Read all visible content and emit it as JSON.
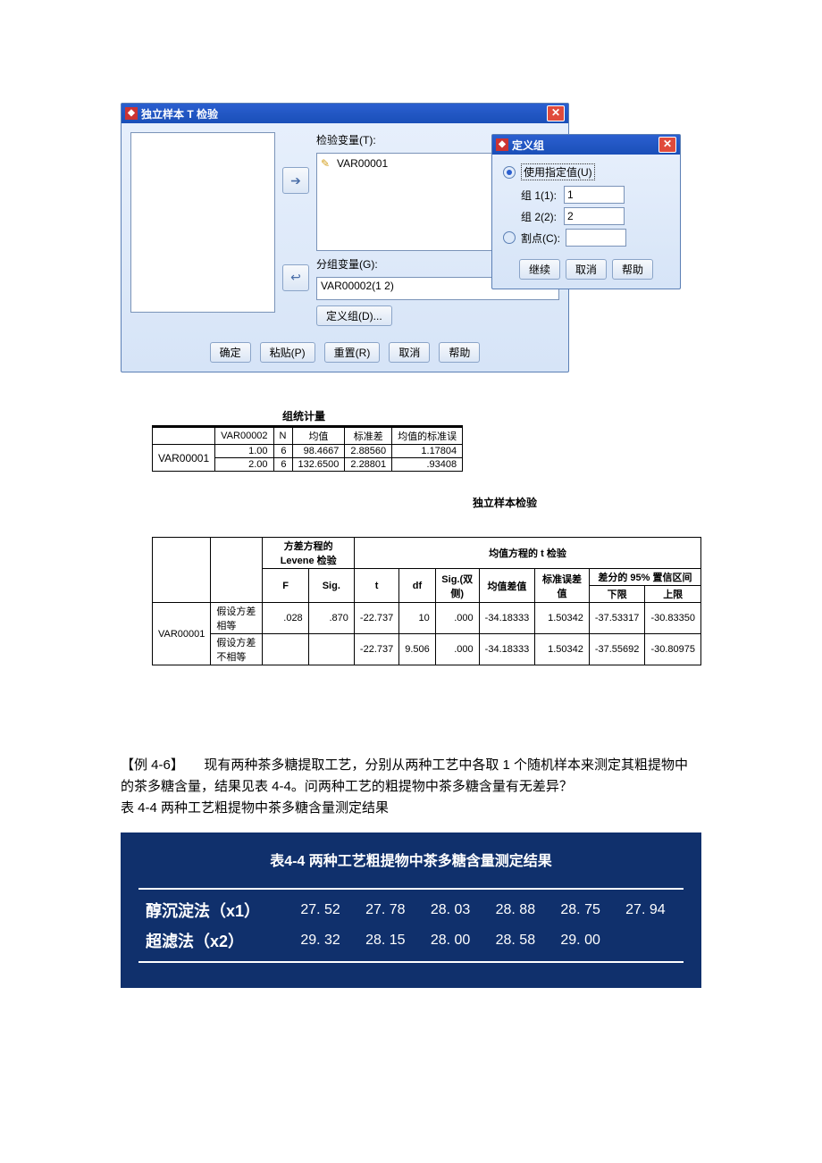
{
  "dlg1": {
    "title": "独立样本 T 检验",
    "test_var_label": "检验变量(T):",
    "test_var_item": "VAR00001",
    "group_var_label": "分组变量(G):",
    "group_var_value": "VAR00002(1 2)",
    "define_group_btn": "定义组(D)...",
    "buttons": {
      "ok": "确定",
      "paste": "粘贴(P)",
      "reset": "重置(R)",
      "cancel": "取消",
      "help": "帮助"
    }
  },
  "dlg2": {
    "title": "定义组",
    "use_specified_label": "使用指定值(U)",
    "group1_label": "组 1(1):",
    "group1_value": "1",
    "group2_label": "组 2(2):",
    "group2_value": "2",
    "cutpoint_label": "割点(C):",
    "buttons": {
      "continue": "继续",
      "cancel": "取消",
      "help": "帮助"
    }
  },
  "group_stats": {
    "title": "组统计量",
    "headers": {
      "grp": "VAR00002",
      "n": "N",
      "mean": "均值",
      "sd": "标准差",
      "se": "均值的标准误"
    },
    "rowvar": "VAR00001",
    "rows": [
      {
        "grp": "1.00",
        "n": "6",
        "mean": "98.4667",
        "sd": "2.88560",
        "se": "1.17804"
      },
      {
        "grp": "2.00",
        "n": "6",
        "mean": "132.6500",
        "sd": "2.28801",
        "se": ".93408"
      }
    ]
  },
  "ind_test": {
    "title": "独立样本检验",
    "levene_header": "方差方程的 Levene 检验",
    "t_header": "均值方程的 t 检验",
    "ci_header": "差分的 95% 置信区间",
    "cols": {
      "F": "F",
      "Sig": "Sig.",
      "t": "t",
      "df": "df",
      "sig2": "Sig.(双侧)",
      "meandiff": "均值差值",
      "sediff": "标准误差值",
      "lower": "下限",
      "upper": "上限"
    },
    "rowvar": "VAR00001",
    "row1_label": "假设方差相等",
    "row2_label": "假设方差不相等",
    "rows": [
      {
        "F": ".028",
        "Sig": ".870",
        "t": "-22.737",
        "df": "10",
        "sig2": ".000",
        "meandiff": "-34.18333",
        "sediff": "1.50342",
        "lower": "-37.53317",
        "upper": "-30.83350"
      },
      {
        "F": "",
        "Sig": "",
        "t": "-22.737",
        "df": "9.506",
        "sig2": ".000",
        "meandiff": "-34.18333",
        "sediff": "1.50342",
        "lower": "-37.55692",
        "upper": "-30.80975"
      }
    ]
  },
  "paragraph": {
    "p1": "【例 4-6】　　现有两种茶多糖提取工艺，分别从两种工艺中各取 1 个随机样本来测定其粗提物中的茶多糖含量，结果见表 4-4。问两种工艺的粗提物中茶多糖含量有无差异？",
    "p2": "表 4-4  两种工艺粗提物中茶多糖含量测定结果"
  },
  "blue": {
    "title": "表4-4 两种工艺粗提物中茶多糖含量测定结果",
    "row1_name": "醇沉淀法（x1）",
    "row1": [
      "27. 52",
      "27. 78",
      "28. 03",
      "28. 88",
      "28. 75",
      "27. 94"
    ],
    "row2_name": "超滤法（x2）",
    "row2": [
      "29. 32",
      "28. 15",
      "28. 00",
      "28. 58",
      "29. 00",
      ""
    ]
  },
  "chart_data": [
    {
      "type": "table",
      "title": "组统计量",
      "columns": [
        "VAR00002",
        "N",
        "均值",
        "标准差",
        "均值的标准误"
      ],
      "rows": [
        [
          "1.00",
          6,
          98.4667,
          2.8856,
          1.17804
        ],
        [
          "2.00",
          6,
          132.65,
          2.28801,
          0.93408
        ]
      ]
    },
    {
      "type": "table",
      "title": "独立样本检验",
      "columns": [
        "假设",
        "F",
        "Sig.",
        "t",
        "df",
        "Sig.(双侧)",
        "均值差值",
        "标准误差值",
        "95%CI下限",
        "95%CI上限"
      ],
      "rows": [
        [
          "假设方差相等",
          0.028,
          0.87,
          -22.737,
          10,
          0.0,
          -34.18333,
          1.50342,
          -37.53317,
          -30.8335
        ],
        [
          "假设方差不相等",
          null,
          null,
          -22.737,
          9.506,
          0.0,
          -34.18333,
          1.50342,
          -37.55692,
          -30.80975
        ]
      ]
    },
    {
      "type": "table",
      "title": "表4-4 两种工艺粗提物中茶多糖含量测定结果",
      "series": [
        {
          "name": "醇沉淀法（x1）",
          "values": [
            27.52,
            27.78,
            28.03,
            28.88,
            28.75,
            27.94
          ]
        },
        {
          "name": "超滤法（x2）",
          "values": [
            29.32,
            28.15,
            28.0,
            28.58,
            29.0
          ]
        }
      ]
    }
  ]
}
